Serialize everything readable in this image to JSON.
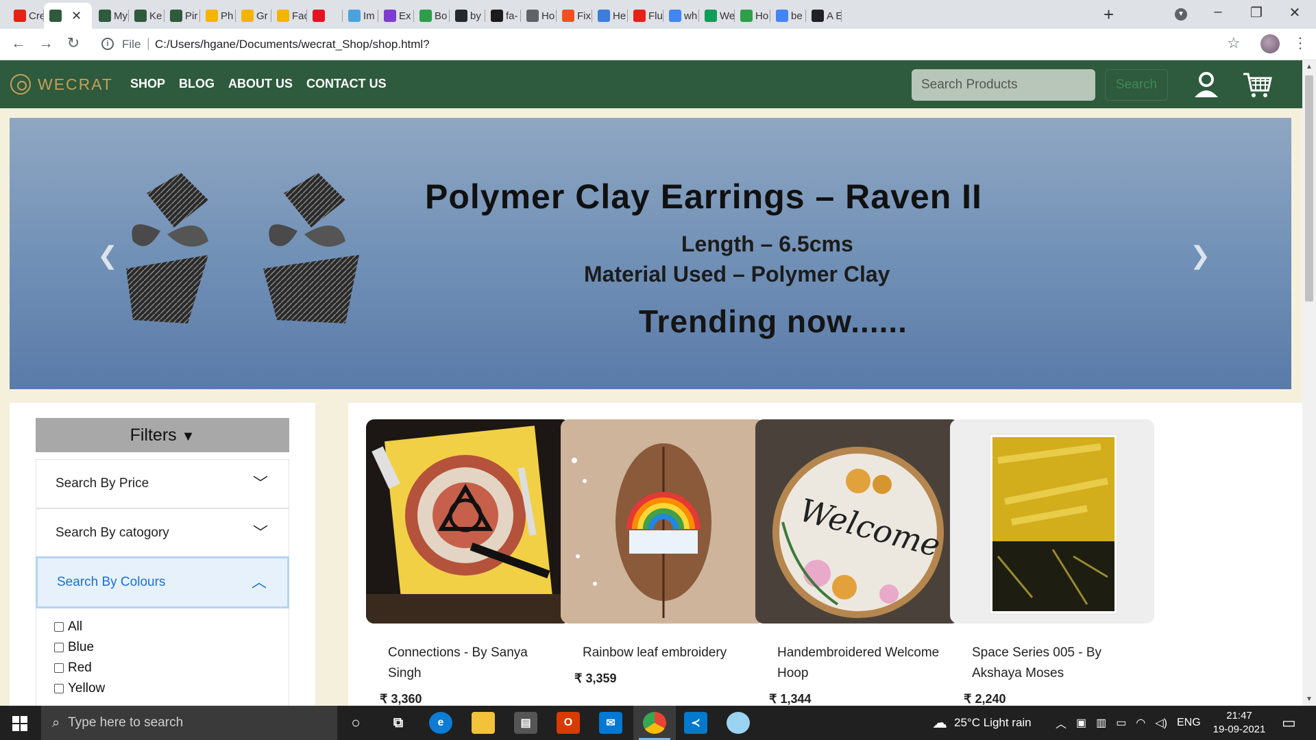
{
  "browser": {
    "tabs": [
      {
        "label": "Cre",
        "favicon": "youtube-icon",
        "color": "#e62117"
      },
      {
        "label": "",
        "favicon": "wecrat-icon",
        "color": "#2e5a3d",
        "active": true
      },
      {
        "label": "My",
        "favicon": "wecrat-icon",
        "color": "#2e5a3d"
      },
      {
        "label": "Ke",
        "favicon": "wecrat-icon",
        "color": "#2e5a3d"
      },
      {
        "label": "Pir",
        "favicon": "wecrat-icon",
        "color": "#2e5a3d"
      },
      {
        "label": "Ph",
        "favicon": "photos-icon",
        "color": "#f4b400"
      },
      {
        "label": "Gr",
        "favicon": "photos-icon",
        "color": "#f4b400"
      },
      {
        "label": "Fac",
        "favicon": "photos-icon",
        "color": "#f4b400"
      },
      {
        "label": "",
        "favicon": "compass-icon",
        "color": "#e81123"
      },
      {
        "label": "Im",
        "favicon": "image-icon",
        "color": "#4aa3df"
      },
      {
        "label": "Ex",
        "favicon": "b-icon",
        "color": "#7e3bd0"
      },
      {
        "label": "Bo",
        "favicon": "w-icon",
        "color": "#2d9f48"
      },
      {
        "label": "by",
        "favicon": "github-icon",
        "color": "#24292e"
      },
      {
        "label": "fa-",
        "favicon": "fontawesome-icon",
        "color": "#1c1c1c"
      },
      {
        "label": "Ho",
        "favicon": "globe-icon",
        "color": "#5f6368"
      },
      {
        "label": "Fix",
        "favicon": "microsoft-icon",
        "color": "#f25022"
      },
      {
        "label": "He",
        "favicon": "flag-icon",
        "color": "#3b7ddd"
      },
      {
        "label": "Flu",
        "favicon": "youtube-icon",
        "color": "#e62117"
      },
      {
        "label": "wh",
        "favicon": "google-icon",
        "color": "#4285f4"
      },
      {
        "label": "We",
        "favicon": "drive-icon",
        "color": "#0f9d58"
      },
      {
        "label": "Ho",
        "favicon": "link-icon",
        "color": "#2d9f48"
      },
      {
        "label": "be",
        "favicon": "google-icon",
        "color": "#4285f4"
      },
      {
        "label": "A E",
        "favicon": "openai-icon",
        "color": "#202124"
      }
    ],
    "address": {
      "scheme_label": "File",
      "url": "C:/Users/hgane/Documents/wecrat_Shop/shop.html?"
    }
  },
  "site": {
    "logo": "WECRAT",
    "nav": [
      "SHOP",
      "BLOG",
      "ABOUT US",
      "CONTACT US"
    ],
    "search_placeholder": "Search Products",
    "search_button": "Search",
    "colors": {
      "nav_bg": "#2e5a3d",
      "accent": "#c3a15a",
      "page_bg": "#f5f0dc"
    }
  },
  "hero": {
    "title": "Polymer Clay Earrings – Raven II",
    "line1": "Length – 6.5cms",
    "line2": "Material Used – Polymer Clay",
    "trend": "Trending now......"
  },
  "filters": {
    "heading": "Filters",
    "sections": [
      "Search By Price",
      "Search By catogory",
      "Search By Colours"
    ],
    "colors": [
      "All",
      "Blue",
      "Red",
      "Yellow"
    ]
  },
  "products": [
    {
      "title": "Connections - By Sanya Singh",
      "price": "₹ 3,360"
    },
    {
      "title": "Rainbow leaf embroidery",
      "price": "₹ 3,359"
    },
    {
      "title": "Handembroidered Welcome Hoop",
      "price": "₹ 1,344"
    },
    {
      "title": "Space Series 005 - By Akshaya Moses",
      "price": "₹ 2,240"
    }
  ],
  "taskbar": {
    "search_placeholder": "Type here to search",
    "weather": "25°C  Light rain",
    "lang": "ENG",
    "time": "21:47",
    "date": "19-09-2021"
  }
}
